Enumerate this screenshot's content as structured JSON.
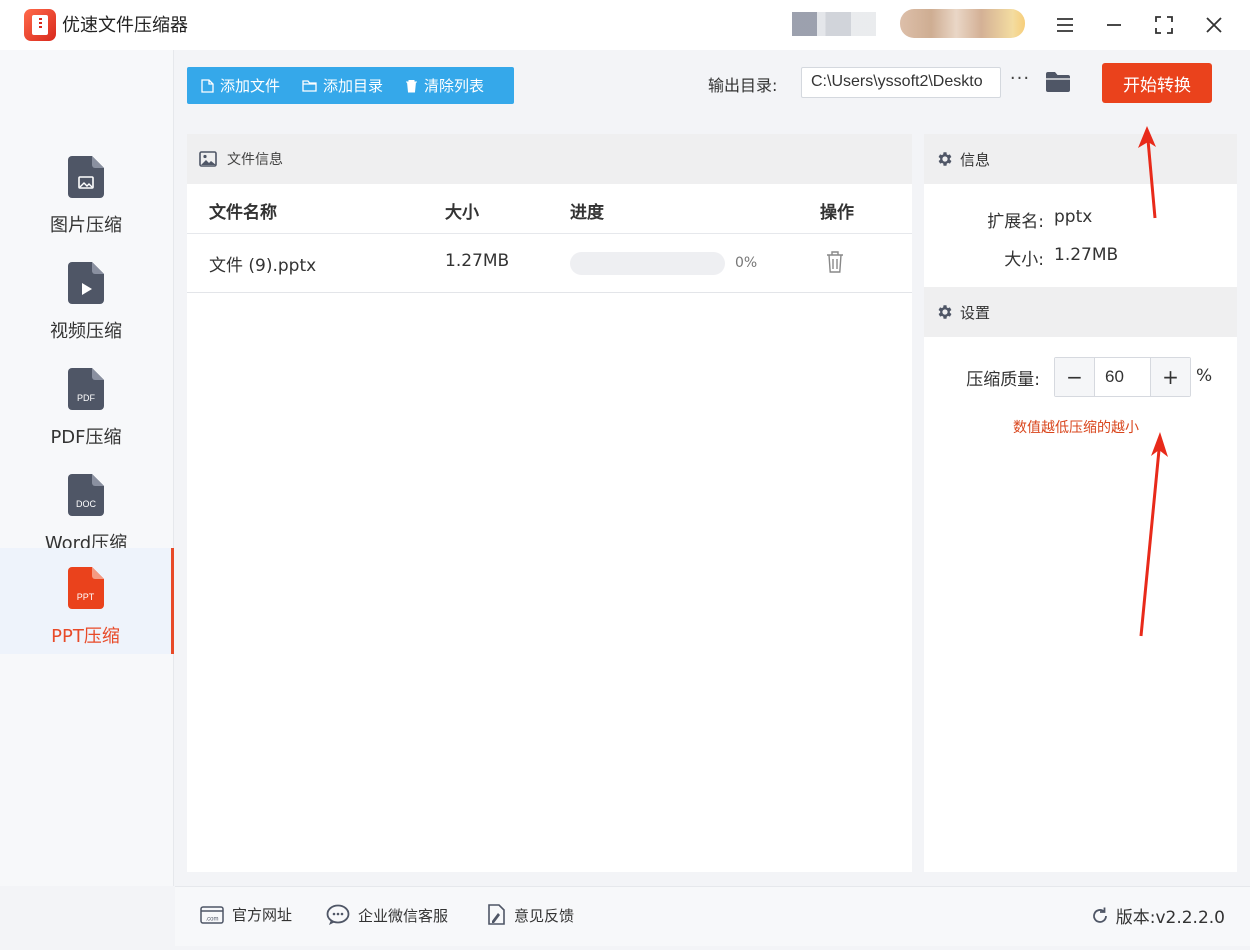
{
  "app": {
    "title": "优速文件压缩器"
  },
  "sidebar": {
    "items": [
      {
        "label": "图片压缩",
        "tag": ""
      },
      {
        "label": "视频压缩",
        "tag": ""
      },
      {
        "label": "PDF压缩",
        "tag": "PDF"
      },
      {
        "label": "Word压缩",
        "tag": "DOC"
      },
      {
        "label": "PPT压缩",
        "tag": "PPT",
        "active": true
      }
    ]
  },
  "toolbar": {
    "add_file": "添加文件",
    "add_folder": "添加目录",
    "clear_list": "清除列表",
    "output_label": "输出目录:",
    "output_path": "C:\\Users\\yssoft2\\Deskto",
    "more": "···",
    "start": "开始转换"
  },
  "file_panel": {
    "title": "文件信息",
    "columns": {
      "name": "文件名称",
      "size": "大小",
      "progress": "进度",
      "action": "操作"
    },
    "rows": [
      {
        "name": "文件 (9).pptx",
        "size": "1.27MB",
        "progress_pct": 0,
        "progress_text": "0%"
      }
    ]
  },
  "info_panel": {
    "title": "信息",
    "ext_label": "扩展名:",
    "ext_value": "pptx",
    "size_label": "大小:",
    "size_value": "1.27MB"
  },
  "settings_panel": {
    "title": "设置",
    "quality_label": "压缩质量:",
    "minus": "−",
    "plus": "+",
    "quality_value": "60",
    "unit": "%",
    "hint": "数值越低压缩的越小"
  },
  "footer": {
    "website": "官方网址",
    "wechat": "企业微信客服",
    "feedback": "意见反馈",
    "version": "版本:v2.2.2.0"
  },
  "colors": {
    "accent": "#ea421c",
    "toolbar": "#35a8ea",
    "icon_gray": "#4f5666"
  }
}
